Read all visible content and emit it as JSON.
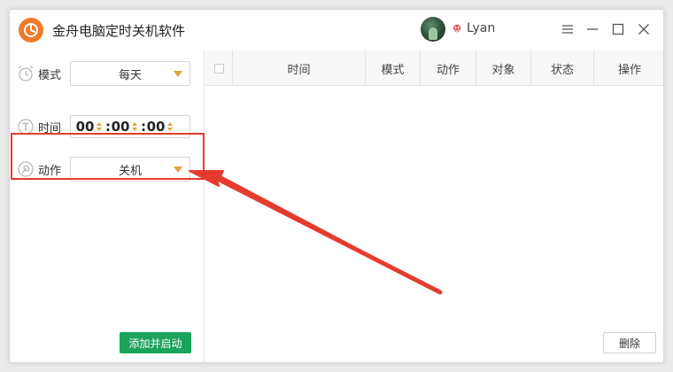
{
  "app": {
    "title": "金舟电脑定时关机软件",
    "username": "Lyan"
  },
  "left_panel": {
    "mode": {
      "label": "模式",
      "value": "每天"
    },
    "time": {
      "label": "时间",
      "hours": "00",
      "minutes": "00",
      "seconds": "00"
    },
    "action": {
      "label": "动作",
      "value": "关机"
    },
    "add_start_label": "添加并启动"
  },
  "table": {
    "columns": [
      "时间",
      "模式",
      "动作",
      "对象",
      "状态",
      "操作"
    ],
    "rows": [],
    "delete_label": "删除"
  },
  "colors": {
    "accent_orange": "#e6a23c",
    "logo_orange": "#f07a2a",
    "primary_green": "#1ba35a",
    "annotation_red": "#e53b2f"
  },
  "icons": {
    "mode": "alarm-clock-icon",
    "time": "timer-icon",
    "action": "wrench-icon",
    "vip": "diamond-icon",
    "menu": "menu-icon",
    "minimize": "minimize-icon",
    "maximize": "maximize-icon",
    "close": "close-icon"
  }
}
